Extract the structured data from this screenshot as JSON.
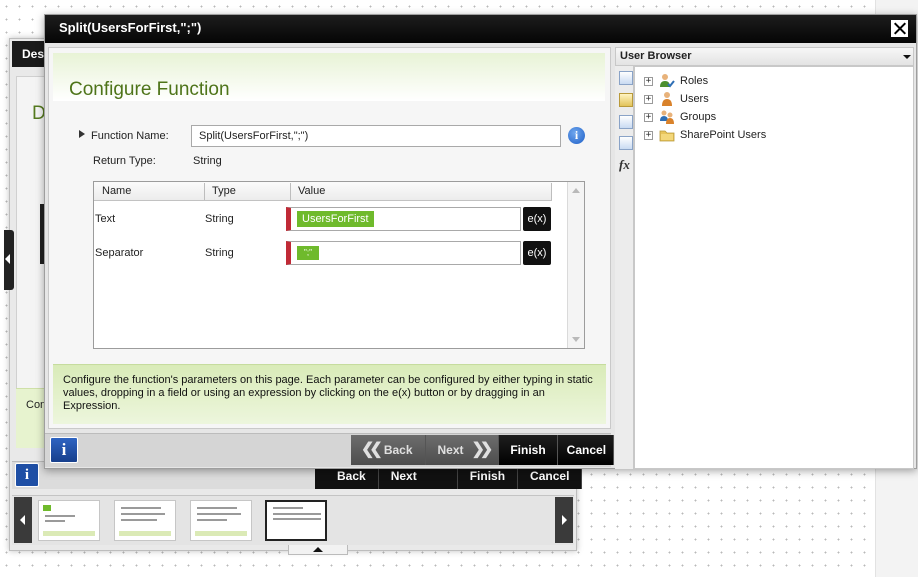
{
  "background_dialog": {
    "title_partial": "Des",
    "heading_partial": "D",
    "help_partial": "Con",
    "nav": {
      "back": "Back",
      "next": "Next",
      "finish": "Finish",
      "cancel": "Cancel"
    },
    "thumbnails_count": 4,
    "selected_thumbnail": 4
  },
  "dialog": {
    "title": "Split(UsersForFirst,\";\")",
    "page_title": "Configure Function",
    "function_name_label": "Function Name:",
    "function_name_value": "Split(UsersForFirst,\";\")",
    "return_type_label": "Return Type:",
    "return_type_value": "String",
    "grid": {
      "columns": [
        "Name",
        "Type",
        "Value"
      ],
      "rows": [
        {
          "name": "Text",
          "type": "String",
          "value": "UsersForFirst",
          "expr": "e(x)"
        },
        {
          "name": "Separator",
          "type": "String",
          "value": "\";\"",
          "expr": "e(x)"
        }
      ]
    },
    "help_text": "Configure the function's parameters on this page.  Each parameter can be configured by either typing in static values, dropping in a field or using an expression by clicking on the e(x) button or by dragging in an Expression.",
    "nav": {
      "back": "Back",
      "next": "Next",
      "finish": "Finish",
      "cancel": "Cancel"
    }
  },
  "user_browser": {
    "title": "User Browser",
    "items": [
      {
        "label": "Roles",
        "icon": "roles-icon"
      },
      {
        "label": "Users",
        "icon": "users-icon"
      },
      {
        "label": "Groups",
        "icon": "groups-icon"
      },
      {
        "label": "SharePoint Users",
        "icon": "sharepoint-users-icon"
      }
    ]
  },
  "colors": {
    "accent_green": "#6fba2c",
    "title_green": "#4e7419",
    "required_red": "#c02a36",
    "info_blue": "#1f5fc7"
  }
}
